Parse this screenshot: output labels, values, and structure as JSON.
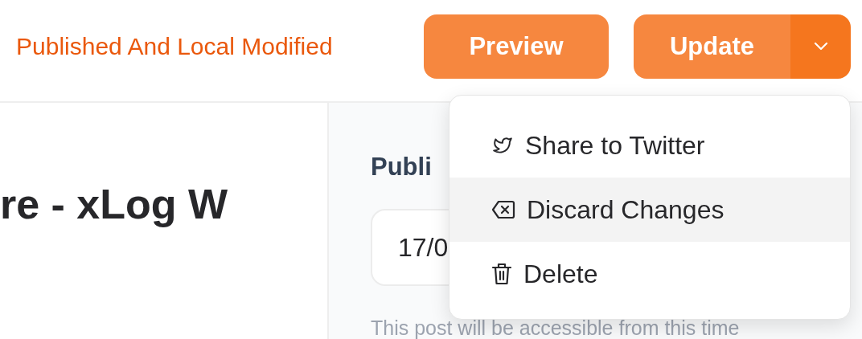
{
  "header": {
    "status": "Published And Local Modified",
    "buttons": [
      {
        "label": "Preview",
        "kind": "plain"
      },
      {
        "label": "Update",
        "kind": "split"
      }
    ]
  },
  "editor": {
    "title": "re - xLog W"
  },
  "settings": {
    "heading": "Publi",
    "date_field": {
      "value": "17/0"
    },
    "hint": "This post will be accessible from this time"
  },
  "menu": {
    "items": [
      {
        "label": "Share to Twitter",
        "kind": "twitter",
        "highlighted": false
      },
      {
        "label": "Discard Changes",
        "kind": "discard",
        "highlighted": true
      },
      {
        "label": "Delete",
        "kind": "delete",
        "highlighted": false
      }
    ]
  }
}
